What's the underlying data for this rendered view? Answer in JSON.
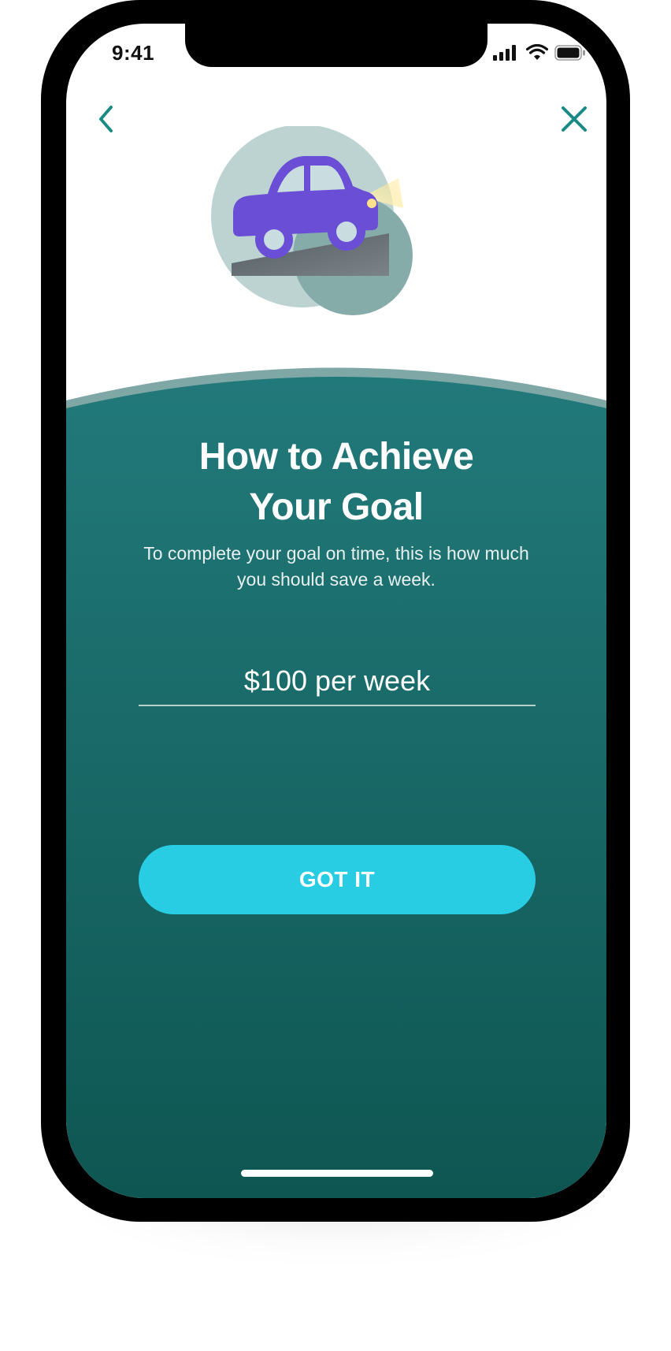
{
  "status_bar": {
    "time": "9:41"
  },
  "nav": {
    "back_icon": "chevron-left-icon",
    "close_icon": "close-icon"
  },
  "content": {
    "title_line1": "How to Achieve",
    "title_line2": "Your Goal",
    "subtitle_line1": "To complete your goal on time, this is how much",
    "subtitle_line2": "you should save a week.",
    "amount_value": "$100 per week",
    "button_label": "GOT IT"
  },
  "colors": {
    "accent": "#1a8a84",
    "panel_top": "#22797a",
    "panel_bottom": "#0e5652",
    "button": "#28cde3",
    "car": "#6a4fd6"
  }
}
